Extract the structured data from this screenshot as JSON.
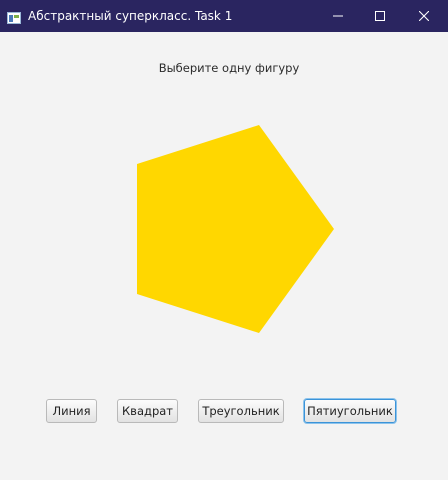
{
  "window": {
    "title": "Абстрактный суперкласс. Task 1",
    "title_bar_color": "#2a2560",
    "controls": [
      "minimize-icon",
      "maximize-icon",
      "close-icon"
    ]
  },
  "main": {
    "prompt": "Выберите одну фигуру",
    "shape": {
      "type": "pentagon",
      "fill": "#ffd700"
    },
    "buttons": [
      {
        "label": "Линия",
        "selected": false
      },
      {
        "label": "Квадрат",
        "selected": false
      },
      {
        "label": "Треугольник",
        "selected": false
      },
      {
        "label": "Пятиугольник",
        "selected": true
      }
    ]
  }
}
